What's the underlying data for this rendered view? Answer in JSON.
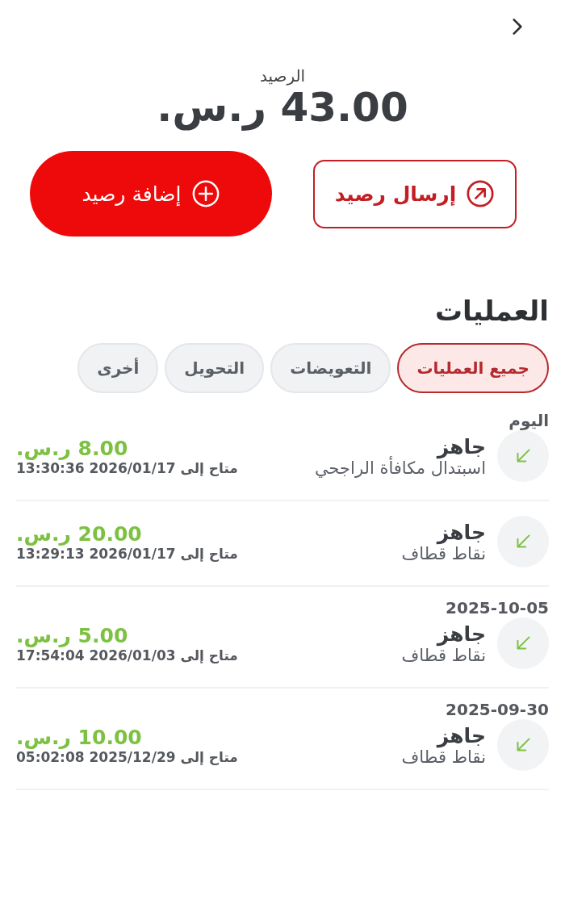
{
  "balance": {
    "label": "الرصيد",
    "amount": "43.00 ر.س."
  },
  "actions": [
    {
      "kind": "outline",
      "label": "إرسال رصيد"
    },
    {
      "kind": "filled",
      "label": "إضافة رصيد"
    }
  ],
  "transactions_title": "العمليات",
  "tabs": [
    {
      "label": "جميع العمليات",
      "selected": true
    },
    {
      "label": "التعويضات",
      "selected": false
    },
    {
      "label": "التحويل",
      "selected": false
    },
    {
      "label": "أخرى",
      "selected": false
    }
  ],
  "groups": [
    {
      "date": "اليوم",
      "items": [
        {
          "status": "جاهز",
          "title": "اسبتدال مكافأة الراجحي",
          "amount": "8.00 ر.س.",
          "expiry": "متاح إلى 2026/01/17 13:30:36"
        },
        {
          "status": "جاهز",
          "title": "نقاط قطاف",
          "amount": "20.00 ر.س.",
          "expiry": "متاح إلى 2026/01/17 13:29:13"
        }
      ]
    },
    {
      "date": "2025-10-05",
      "items": [
        {
          "status": "جاهز",
          "title": "نقاط قطاف",
          "amount": "5.00 ر.س.",
          "expiry": "متاح إلى 2026/01/03 17:54:04"
        }
      ]
    },
    {
      "date": "2025-09-30",
      "items": [
        {
          "status": "جاهز",
          "title": "نقاط قطاف",
          "amount": "10.00 ر.س.",
          "expiry": "متاح إلى 2025/12/29 05:02:08"
        }
      ]
    }
  ]
}
